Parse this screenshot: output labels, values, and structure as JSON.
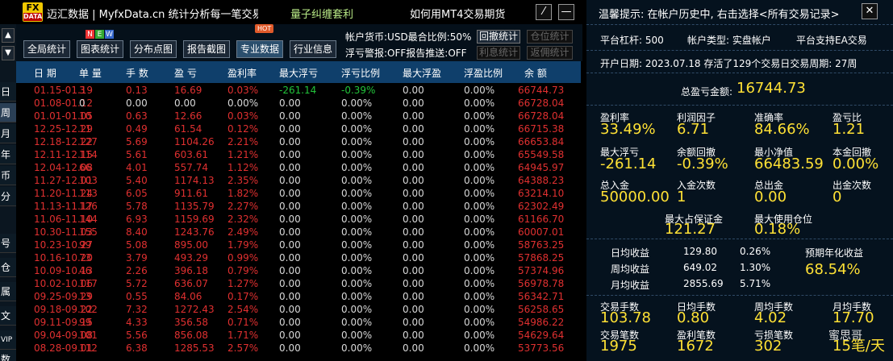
{
  "titlebar": {
    "logo_top": "FX",
    "logo_bottom": "DATA",
    "title": "迈汇数据 | MyfxData.cn  统计分析每一笔交易",
    "promo1": "量子纠缠套利",
    "promo2": "如何用MT4交易期货",
    "edit_label": "⁄",
    "min_label": "—"
  },
  "sidetabs": [
    "日",
    "周",
    "月",
    "年",
    "币",
    "分",
    "号",
    "仓",
    "属",
    "文",
    "VIP",
    "数"
  ],
  "toolbar": {
    "buttons": [
      "全局统计",
      "图表统计",
      "分布点图",
      "报告截图",
      "专业数据",
      "行业信息"
    ],
    "new_badge": [
      "N",
      "E",
      "W"
    ],
    "hot_badge": "HOT",
    "info1": "帐户货币:USD最合比例:50%",
    "info2": "浮亏警报:OFF报告推送:OFF",
    "btn_recall": "回撤统计",
    "btn_position": "仓位统计",
    "btn_interest": "利息统计",
    "btn_rebate": "返佣统计"
  },
  "table": {
    "headers": [
      "日 期",
      "单 量",
      "手 数",
      "盈 亏",
      "盈利率",
      "最大浮亏",
      "浮亏比例",
      "最大浮盈",
      "浮盈比例",
      "余 额"
    ],
    "rows": [
      [
        "01.15-01.19",
        "3",
        "0.13",
        "16.69",
        "0.03%",
        "-261.14",
        "-0.39%",
        "0.00",
        "0.00%",
        "66744.73"
      ],
      [
        "01.08-01.12",
        "0",
        "0.00",
        "0.00",
        "0.00%",
        "0.00",
        "0.00%",
        "0.00",
        "0.00%",
        "66728.04"
      ],
      [
        "01.01-01.05",
        "10",
        "0.63",
        "12.66",
        "0.03%",
        "0.00",
        "0.00%",
        "0.00",
        "0.00%",
        "66728.04"
      ],
      [
        "12.25-12.29",
        "11",
        "0.49",
        "61.54",
        "0.12%",
        "0.00",
        "0.00%",
        "0.00",
        "0.00%",
        "66715.38"
      ],
      [
        "12.18-12.22",
        "127",
        "5.69",
        "1104.26",
        "2.21%",
        "0.00",
        "0.00%",
        "0.00",
        "0.00%",
        "66653.84"
      ],
      [
        "12.11-12.15",
        "114",
        "5.61",
        "603.61",
        "1.21%",
        "0.00",
        "0.00%",
        "0.00",
        "0.00%",
        "65549.58"
      ],
      [
        "12.04-12.08",
        "66",
        "4.01",
        "557.74",
        "1.12%",
        "0.00",
        "0.00%",
        "0.00",
        "0.00%",
        "64945.97"
      ],
      [
        "11.27-12.01",
        "103",
        "5.40",
        "1174.13",
        "2.35%",
        "0.00",
        "0.00%",
        "0.00",
        "0.00%",
        "64388.23"
      ],
      [
        "11.20-11.24",
        "113",
        "6.05",
        "911.61",
        "1.82%",
        "0.00",
        "0.00%",
        "0.00",
        "0.00%",
        "63214.10"
      ],
      [
        "11.13-11.17",
        "126",
        "5.78",
        "1135.79",
        "2.27%",
        "0.00",
        "0.00%",
        "0.00",
        "0.00%",
        "62302.49"
      ],
      [
        "11.06-11.10",
        "144",
        "6.93",
        "1159.69",
        "2.32%",
        "0.00",
        "0.00%",
        "0.00",
        "0.00%",
        "61166.70"
      ],
      [
        "10.30-11.03",
        "155",
        "8.40",
        "1243.76",
        "2.49%",
        "0.00",
        "0.00%",
        "0.00",
        "0.00%",
        "60007.01"
      ],
      [
        "10.23-10.27",
        "99",
        "5.08",
        "895.00",
        "1.79%",
        "0.00",
        "0.00%",
        "0.00",
        "0.00%",
        "58763.25"
      ],
      [
        "10.16-10.20",
        "73",
        "3.79",
        "493.29",
        "0.99%",
        "0.00",
        "0.00%",
        "0.00",
        "0.00%",
        "57868.25"
      ],
      [
        "10.09-10.13",
        "46",
        "2.26",
        "396.18",
        "0.79%",
        "0.00",
        "0.00%",
        "0.00",
        "0.00%",
        "57374.96"
      ],
      [
        "10.02-10.06",
        "117",
        "5.72",
        "636.07",
        "1.27%",
        "0.00",
        "0.00%",
        "0.00",
        "0.00%",
        "56978.78"
      ],
      [
        "09.25-09.29",
        "13",
        "0.55",
        "84.06",
        "0.17%",
        "0.00",
        "0.00%",
        "0.00",
        "0.00%",
        "56342.71"
      ],
      [
        "09.18-09.22",
        "102",
        "7.32",
        "1272.43",
        "2.54%",
        "0.00",
        "0.00%",
        "0.00",
        "0.00%",
        "56258.65"
      ],
      [
        "09.11-09.15",
        "99",
        "4.33",
        "356.58",
        "0.71%",
        "0.00",
        "0.00%",
        "0.00",
        "0.00%",
        "54986.22"
      ],
      [
        "09.04-09.08",
        "101",
        "5.56",
        "856.08",
        "1.71%",
        "0.00",
        "0.00%",
        "0.00",
        "0.00%",
        "54629.64"
      ],
      [
        "08.28-09.01",
        "112",
        "6.38",
        "1285.53",
        "2.57%",
        "0.00",
        "0.00%",
        "0.00",
        "0.00%",
        "53773.56"
      ]
    ]
  },
  "right": {
    "tip": "温馨提示: 在帐户历史中, 右击选择<所有交易记录>",
    "close_label": "✕",
    "leverage": "平台杠杆: 500",
    "account_type": "帐户类型: 实盘帐户",
    "ea": "平台支持EA交易",
    "open_date": "开户日期: 2023.07.18 存活了129个交易日交易周期: 27周",
    "total_label": "总盈亏金额:",
    "total_value": "16744.73",
    "stats": [
      {
        "label": "盈利率",
        "value": "33.49%"
      },
      {
        "label": "利润因子",
        "value": "6.71"
      },
      {
        "label": "准确率",
        "value": "84.66%"
      },
      {
        "label": "盈亏比",
        "value": "1.21"
      },
      {
        "label": "最大浮亏",
        "value": "-261.14"
      },
      {
        "label": "余额回撤",
        "value": "-0.39%"
      },
      {
        "label": "最小净值",
        "value": "66483.59"
      },
      {
        "label": "本金回撤",
        "value": "0.00%"
      },
      {
        "label": "总入金",
        "value": "50000.00"
      },
      {
        "label": "入金次数",
        "value": "1"
      },
      {
        "label": "总出金",
        "value": "0.00"
      },
      {
        "label": "出金次数",
        "value": "0"
      }
    ],
    "margin_label": "最大占保证金",
    "margin_value": "121.27",
    "maxpos_label": "最大使用仓位",
    "maxpos_value": "0.18%",
    "income": [
      {
        "label": "日均收益",
        "amount": "129.80",
        "pct": "0.26%"
      },
      {
        "label": "周均收益",
        "amount": "649.02",
        "pct": "1.30%"
      },
      {
        "label": "月均收益",
        "amount": "2855.69",
        "pct": "5.71%"
      }
    ],
    "annual_label": "预期年化收益",
    "annual_value": "68.54%",
    "trade_stats": [
      {
        "label": "交易手数",
        "value": "103.78"
      },
      {
        "label": "日均手数",
        "value": "0.80"
      },
      {
        "label": "周均手数",
        "value": "4.02"
      },
      {
        "label": "月均手数",
        "value": "17.70"
      },
      {
        "label": "交易笔数",
        "value": "1975"
      },
      {
        "label": "盈利笔数",
        "value": "1672"
      },
      {
        "label": "亏损笔数",
        "value": "302"
      },
      {
        "label": "",
        "value": "15笔/天"
      }
    ],
    "watermark": "蜜思哥"
  },
  "colors": {
    "header_bg": "#0f3f6b",
    "profit": "#e03030",
    "value_yellow": "#ffe135",
    "green": "#22c33a"
  }
}
